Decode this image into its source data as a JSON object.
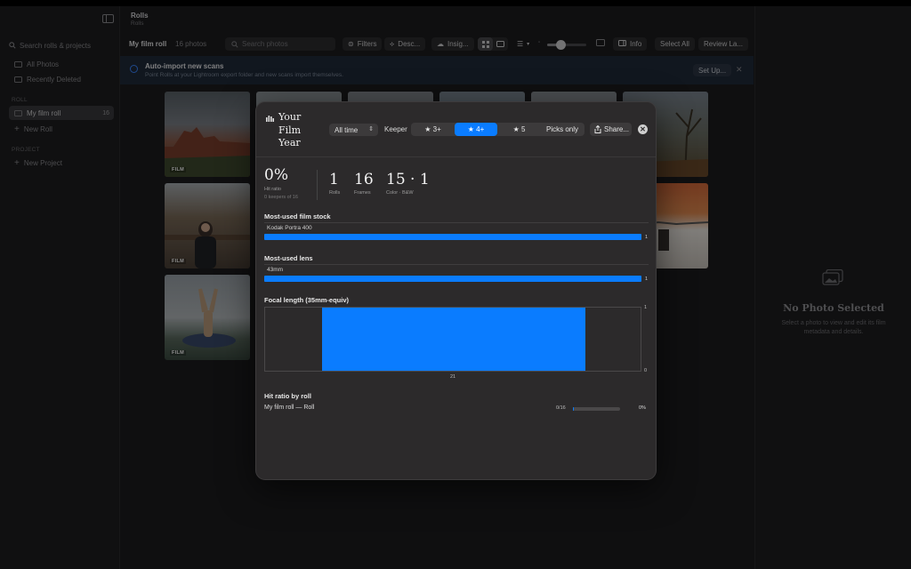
{
  "sidebar": {
    "search_placeholder": "Search rolls & projects",
    "library": [
      {
        "label": "All Photos"
      },
      {
        "label": "Recently Deleted"
      }
    ],
    "rolls_header": "ROLL",
    "rolls": [
      {
        "label": "My film roll",
        "count": "16"
      }
    ],
    "new_roll": "New Roll",
    "projects_header": "PROJECT",
    "new_project": "New Project"
  },
  "header": {
    "title": "Rolls",
    "subtitle": "Rolls"
  },
  "toolbar": {
    "roll_name": "My film roll",
    "photo_count": "16 photos",
    "search_placeholder": "Search photos",
    "filters": "Filters",
    "describe": "Desc...",
    "insights": "Insig...",
    "info": "Info",
    "select_all": "Select All",
    "review": "Review La...",
    "zoom_level": 0.35
  },
  "banner": {
    "title": "Auto-import new scans",
    "subtitle": "Point Rolls at your Lightroom export folder and new scans import themselves.",
    "setup_button": "Set Up..."
  },
  "photos": [
    {
      "tag": "FILM"
    },
    {
      "tag": ""
    },
    {
      "tag": ""
    },
    {
      "tag": ""
    },
    {
      "tag": ""
    },
    {
      "tag": ""
    },
    {
      "tag": "FILM"
    },
    {
      "tag": ""
    },
    {
      "tag": "FILM"
    }
  ],
  "right_panel": {
    "title": "No Photo Selected",
    "subtitle": "Select a photo to view and edit its film metadata and details."
  },
  "modal": {
    "title": "Your Film Year",
    "period": "All time",
    "keeper_label": "Keeper",
    "keeper_options": [
      "★ 3+",
      "★ 4+",
      "★ 5",
      "Picks only"
    ],
    "keeper_selected": "★ 4+",
    "share": "Share...",
    "stats": {
      "hit_ratio": "0%",
      "hit_ratio_label": "Hit ratio",
      "hit_ratio_sub": "0 keepers of 16",
      "rolls": "1",
      "rolls_label": "Rolls",
      "frames": "16",
      "frames_label": "Frames",
      "color_bw": "15 · 1",
      "color_bw_label": "Color · B&W"
    },
    "film_stock": {
      "title": "Most-used film stock",
      "items": [
        {
          "label": "Kodak Portra 400",
          "value": 1,
          "value_label": "1"
        }
      ]
    },
    "lens": {
      "title": "Most-used lens",
      "items": [
        {
          "label": "43mm",
          "value": 1,
          "value_label": "1"
        }
      ]
    },
    "focal": {
      "title": "Focal length (35mm-equiv)"
    },
    "hit_by_roll": {
      "title": "Hit ratio by roll",
      "rows": [
        {
          "name": "My film roll — Roll",
          "fraction": "0/16",
          "ratio": 0.02,
          "pct": "0%"
        }
      ]
    }
  },
  "chart_data": {
    "type": "bar",
    "categories": [
      "21"
    ],
    "values": [
      1
    ],
    "title": "Focal length (35mm-equiv)",
    "xlabel": "",
    "ylabel": "",
    "ylim": [
      0,
      1
    ],
    "y_ticks": [
      "1",
      "0"
    ]
  },
  "colors": {
    "accent": "#0a7cff",
    "modal_bg": "#2c2a2b",
    "app_bg": "#1c1c1e"
  }
}
